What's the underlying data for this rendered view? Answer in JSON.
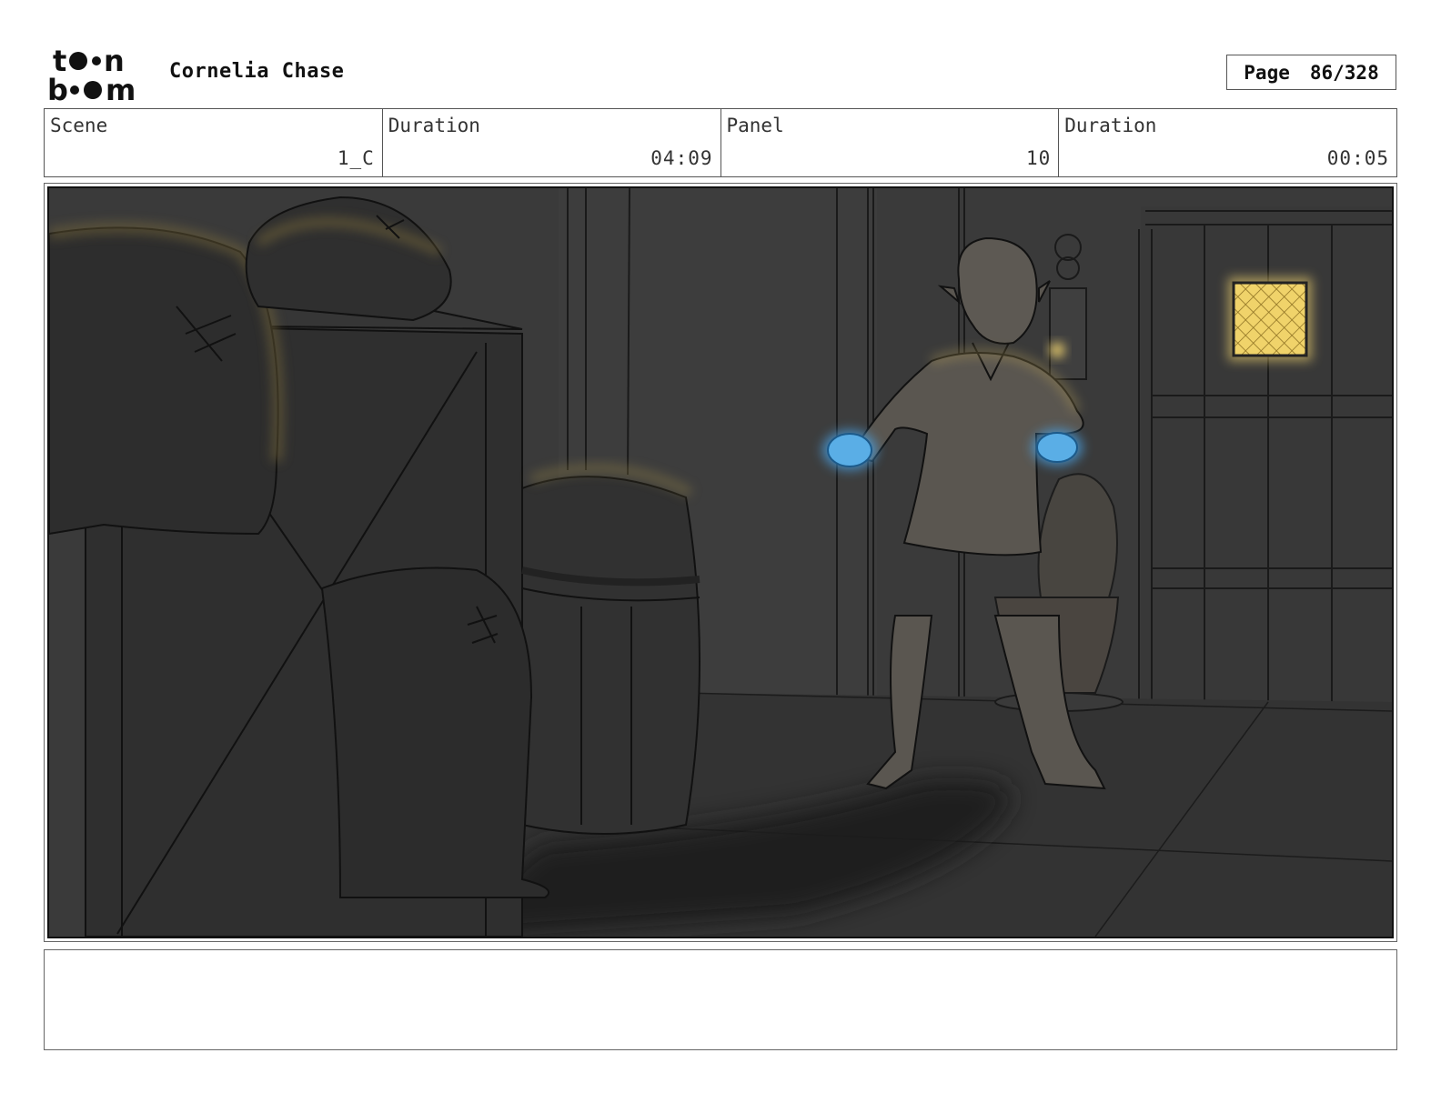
{
  "header": {
    "logo": {
      "alt": "toon boom",
      "line1": "toon",
      "line2": "boom"
    },
    "project_title": "Cornelia Chase",
    "page_label": "Page",
    "page_number": "86/328"
  },
  "info_row": [
    {
      "label": "Scene",
      "value": "1_C"
    },
    {
      "label": "Duration",
      "value": "04:09"
    },
    {
      "label": "Panel",
      "value": "10"
    },
    {
      "label": "Duration",
      "value": "00:05"
    }
  ],
  "panel_image": {
    "description_icon": "storyboard-panel-image"
  },
  "notes": {
    "text": ""
  }
}
